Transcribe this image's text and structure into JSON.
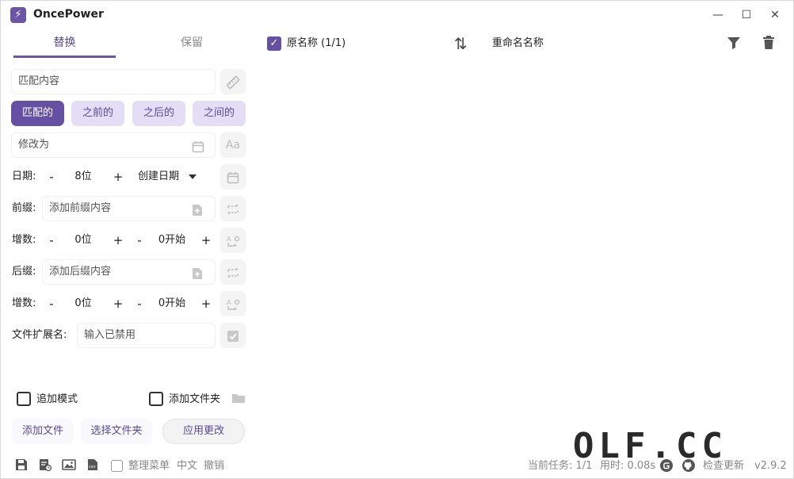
{
  "window": {
    "title": "OncePower",
    "app_icon_glyph": "⚡",
    "minimize_glyph": "—",
    "maximize_glyph": "☐",
    "close_glyph": "✕"
  },
  "tabs": [
    {
      "label": "替换",
      "active": true
    },
    {
      "label": "保留",
      "active": false
    }
  ],
  "match": {
    "placeholder": "匹配内容",
    "modes": [
      "匹配的",
      "之前的",
      "之后的",
      "之间的"
    ],
    "selected_mode": 0
  },
  "modify": {
    "placeholder": "修改为"
  },
  "date": {
    "label": "日期:",
    "digits": "8位",
    "type": "创建日期",
    "minus": "-",
    "plus": "+"
  },
  "prefix": {
    "label": "前缀:",
    "placeholder": "添加前缀内容"
  },
  "prefix_increment": {
    "label": "增数:",
    "digits": "0位",
    "start": "0开始",
    "minus": "-",
    "plus": "+"
  },
  "suffix": {
    "label": "后缀:",
    "placeholder": "添加后缀内容"
  },
  "suffix_increment": {
    "label": "增数:",
    "digits": "0位",
    "start": "0开始",
    "minus": "-",
    "plus": "+"
  },
  "extension": {
    "label": "文件扩展名:",
    "placeholder": "输入已禁用"
  },
  "options": {
    "append_mode": "追加模式",
    "add_folder": "添加文件夹"
  },
  "actions": {
    "add_files": "添加文件",
    "select_folder": "选择文件夹",
    "apply": "应用更改"
  },
  "list_header": {
    "original_name": "原名称 (1/1)",
    "new_name": "重命名名称"
  },
  "statusbar": {
    "organize_menu": "整理菜单",
    "language": "中文",
    "undo": "撤销",
    "current_task": "当前任务: 1/1",
    "elapsed": "用时: 0.08s",
    "check_update": "检查更新",
    "version": "v2.9.2"
  },
  "watermark": "OLF.CC",
  "colors": {
    "accent": "#6650a4",
    "accent_light": "#e3def5"
  }
}
